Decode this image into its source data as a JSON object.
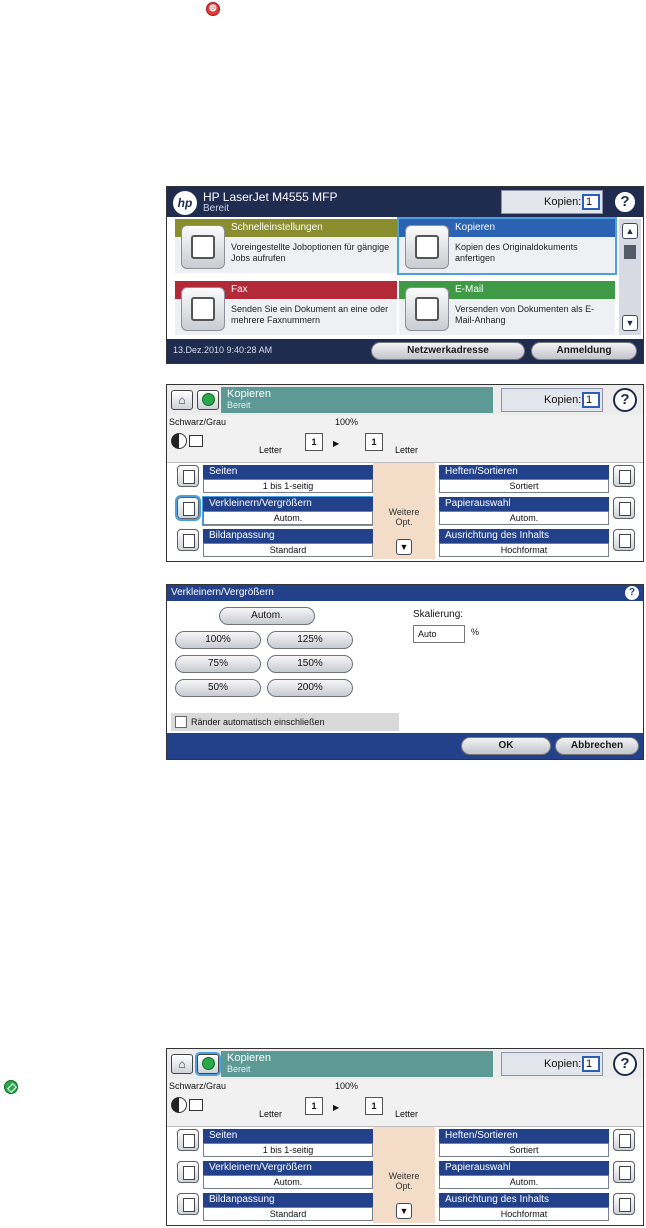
{
  "doc": {
    "stop_icon": "stop-icon",
    "start_icon": "start-icon",
    "stop_glyph": "⊗"
  },
  "home": {
    "device_name": "HP LaserJet M4555 MFP",
    "status": "Bereit",
    "logo": "hp",
    "copies_label": "Kopien:",
    "copies_value": "1",
    "help_glyph": "?",
    "tiles": [
      {
        "title": "Schnelleinstellungen",
        "desc": "Voreingestellte Joboptionen für gängige Jobs aufrufen",
        "color": "#8a8d2e"
      },
      {
        "title": "Kopieren",
        "desc": "Kopien des Originaldokuments anfertigen",
        "color": "#2b63b2"
      },
      {
        "title": "Fax",
        "desc": "Senden Sie ein Dokument an eine oder mehrere Faxnummern",
        "color": "#b22a37"
      },
      {
        "title": "E-Mail",
        "desc": "Versenden von Dokumenten als E-Mail-Anhang",
        "color": "#3f9a45"
      }
    ],
    "datetime": "13.Dez.2010 9:40:28 AM",
    "network_button": "Netzwerkadresse",
    "login_button": "Anmeldung"
  },
  "copy": {
    "title": "Kopieren",
    "status": "Bereit",
    "copies_label": "Kopien:",
    "copies_value": "1",
    "mode": "Schwarz/Grau",
    "zoom": "100%",
    "letter_left": "Letter",
    "letter_right": "Letter",
    "in_count": "1",
    "out_count": "1",
    "options_left": [
      {
        "label": "Seiten",
        "value": "1 bis 1-seitig"
      },
      {
        "label": "Verkleinern/Vergrößern",
        "value": "Autom."
      },
      {
        "label": "Bildanpassung",
        "value": "Standard"
      }
    ],
    "options_right": [
      {
        "label": "Heften/Sortieren",
        "value": "Sortiert"
      },
      {
        "label": "Papierauswahl",
        "value": "Autom."
      },
      {
        "label": "Ausrichtung des Inhalts",
        "value": "Hochformat"
      }
    ],
    "more_line1": "Weitere",
    "more_line2": "Opt."
  },
  "dialog": {
    "title": "Verkleinern/Vergrößern",
    "auto_button": "Autom.",
    "sizes": [
      "100%",
      "125%",
      "75%",
      "150%",
      "50%",
      "200%"
    ],
    "checkbox_label": "Ränder automatisch einschließen",
    "scaling_label": "Skalierung:",
    "scaling_value": "Auto",
    "scaling_unit": "%",
    "ok_button": "OK",
    "cancel_button": "Abbrechen"
  },
  "colors": {
    "navy": "#1f2b4f",
    "blue": "#23418a",
    "teal": "#5d9a96"
  }
}
